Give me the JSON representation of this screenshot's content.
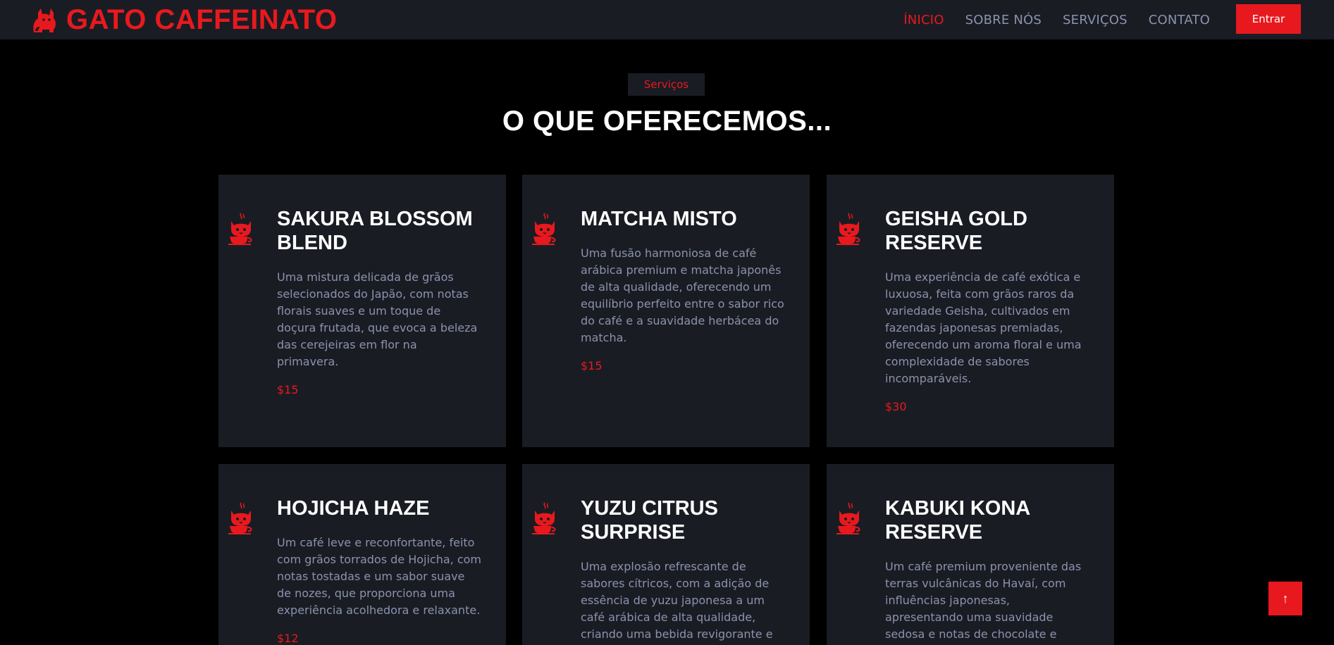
{
  "colors": {
    "accent": "#e8191e",
    "card_bg": "#1a1c23",
    "nav_bg": "#1a1c23",
    "muted_text": "#8a93ad",
    "page_bg": "#000000"
  },
  "header": {
    "brand_text": "GATO CAFFEINATO",
    "brand_icon": "cat-icon",
    "nav": [
      {
        "label": "ÍNICIO",
        "active": true
      },
      {
        "label": "SOBRE NÓS",
        "active": false
      },
      {
        "label": "SERVIÇOS",
        "active": false
      },
      {
        "label": "CONTATO",
        "active": false
      }
    ],
    "login_label": "Entrar"
  },
  "section": {
    "label": "Serviços",
    "title": "O QUE OFERECEMOS..."
  },
  "products": [
    {
      "name": "SAKURA BLOSSOM BLEND",
      "description": "Uma mistura delicada de grãos selecionados do Japão, com notas florais suaves e um toque de doçura frutada, que evoca a beleza das cerejeiras em flor na primavera.",
      "price": "$15",
      "icon": "cat-coffee-icon"
    },
    {
      "name": "MATCHA MISTO",
      "description": "Uma fusão harmoniosa de café arábica premium e matcha japonês de alta qualidade, oferecendo um equilíbrio perfeito entre o sabor rico do café e a suavidade herbácea do matcha.",
      "price": "$15",
      "icon": "cat-coffee-icon"
    },
    {
      "name": "GEISHA GOLD RESERVE",
      "description": "Uma experiência de café exótica e luxuosa, feita com grãos raros da variedade Geisha, cultivados em fazendas japonesas premiadas, oferecendo um aroma floral e uma complexidade de sabores incomparáveis.",
      "price": "$30",
      "icon": "cat-coffee-icon"
    },
    {
      "name": "HOJICHA HAZE",
      "description": "Um café leve e reconfortante, feito com grãos torrados de Hojicha, com notas tostadas e um sabor suave de nozes, que proporciona uma experiência acolhedora e relaxante.",
      "price": "$12",
      "icon": "cat-coffee-icon"
    },
    {
      "name": "YUZU CITRUS SURPRISE",
      "description": "Uma explosão refrescante de sabores cítricos, com a adição de essência de yuzu japonesa a um café arábica de alta qualidade, criando uma bebida revigorante e cheia de vitalidade.",
      "price": "",
      "icon": "cat-coffee-icon"
    },
    {
      "name": "KABUKI KONA RESERVE",
      "description": "Um café premium proveniente das terras vulcânicas do Havaí, com influências japonesas, apresentando uma suavidade sedosa e notas de chocolate e frutas tropicais, que",
      "price": "",
      "icon": "cat-coffee-icon"
    }
  ],
  "scroll_top": {
    "icon": "arrow-up-icon",
    "glyph": "↑"
  }
}
